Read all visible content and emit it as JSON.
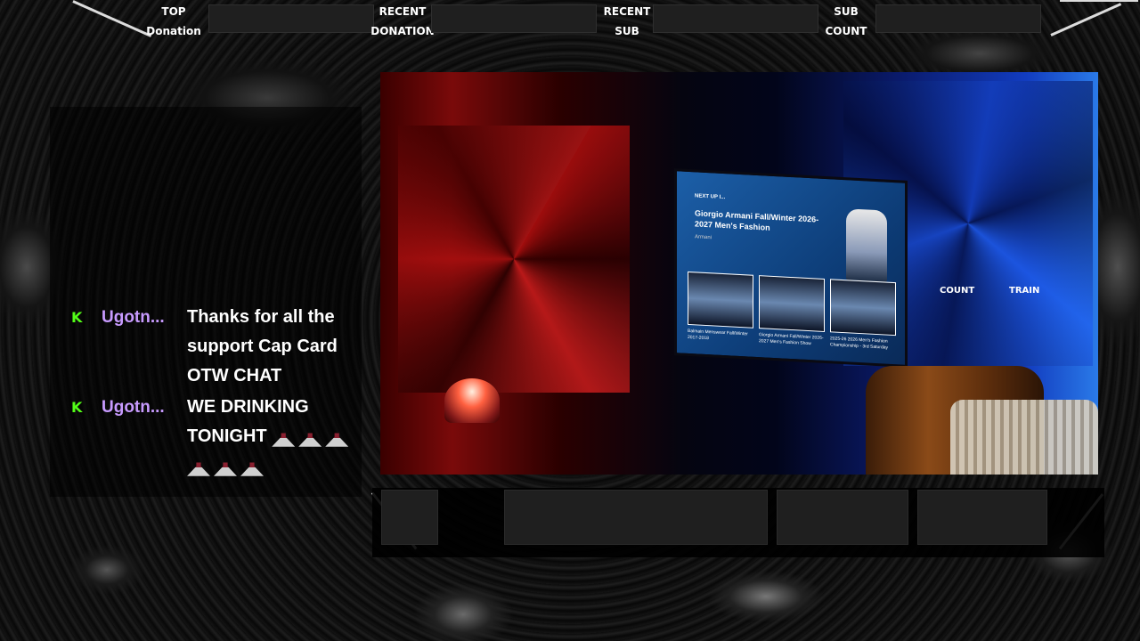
{
  "topbar": {
    "top_donation": {
      "label_line1": "TOP",
      "label_line2": "Donation"
    },
    "recent_donation": {
      "label_line1": "RECENT",
      "label_line2": "DONATION"
    },
    "recent_sub": {
      "label_line1": "RECENT",
      "label_line2": "SUB"
    },
    "sub_count": {
      "label_line1": "SUB",
      "label_line2": "COUNT"
    }
  },
  "chat": {
    "messages": [
      {
        "badge": "K",
        "username": "Ugotn...",
        "text": "Thanks for all the support Cap Card OTW CHAT"
      },
      {
        "badge": "K",
        "username": "Ugotn...",
        "text": "WE DRINKING TONIGHT",
        "emotes": [
          "bottle-emote",
          "bottle-emote",
          "bottle-emote",
          "bottle-emote",
          "bottle-emote",
          "bottle-emote"
        ]
      }
    ]
  },
  "camera": {
    "overlay_labels": {
      "count": "COUNT",
      "train": "TRAIN"
    },
    "tv": {
      "header": "NEXT UP I...",
      "title": "Giorgio Armani Fall/Winter 2026-2027 Men's Fashion",
      "subtitle": "Armani",
      "thumbs": [
        {
          "caption": "Balmain Menswear Fall/Winter 2017-2018"
        },
        {
          "caption": "Giorgio Armani Fall/Winter 2026-2027 Men's Fashion Show"
        },
        {
          "caption": "2025-26 2026 Men's Fashion Championship - 3rd Saturday"
        }
      ]
    }
  },
  "colors": {
    "kick_green": "#53fc18",
    "username_purple": "#c89bff",
    "panel_box": "#1f1f1f"
  }
}
